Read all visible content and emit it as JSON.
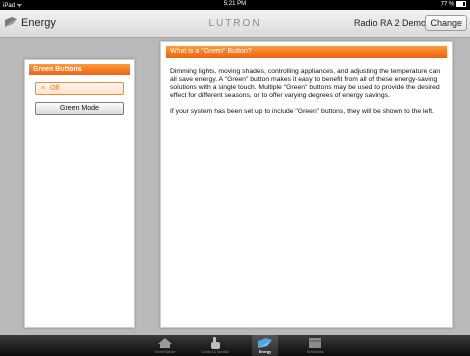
{
  "status_bar": {
    "carrier": "iPad ᯤ",
    "time": "5:21 PM",
    "battery": "77 %",
    "battery_level": 0.77
  },
  "header": {
    "title": "Energy",
    "brand": "LUTRON",
    "system_name": "Radio RA 2 Demo",
    "change_label": "Change"
  },
  "left_panel": {
    "title": "Green Buttons",
    "buttons": [
      {
        "label": "Off",
        "state_mark": "×",
        "active": true
      },
      {
        "label": "Green Mode",
        "active": false
      }
    ]
  },
  "right_panel": {
    "title": "What is a \"Green\" Button?",
    "paragraphs": [
      "Dimming lights, moving shades, controlling appliances, and adjusting the temperature can all save energy. A \"Green\" button makes it easy to benefit from all of these energy-saving solutions with a single touch. Multiple \"Green\" buttons may be used to provide the desired effect for different seasons, or to offer varying degrees of energy savings.",
      "If your system has been set up to include \"Green\" buttons, they will be shown to the left."
    ]
  },
  "tab_bar": {
    "tabs": [
      {
        "label": "HomeGlance",
        "icon": "home-icon",
        "active": false
      },
      {
        "label": "Control & Monitor",
        "icon": "hand-icon",
        "active": false
      },
      {
        "label": "Energy",
        "icon": "energy-icon",
        "active": true
      },
      {
        "label": "Schedules",
        "icon": "calendar-icon",
        "active": false
      }
    ]
  }
}
